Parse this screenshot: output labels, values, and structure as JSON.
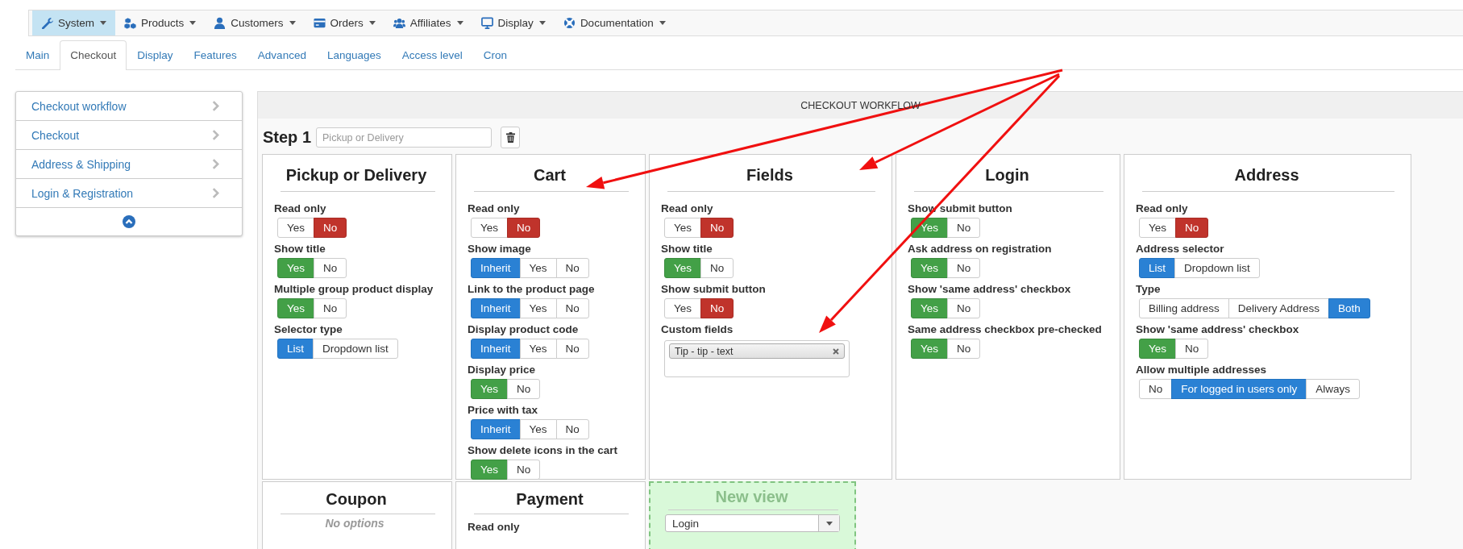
{
  "menu": [
    {
      "label": "System",
      "selected": true
    },
    {
      "label": "Products",
      "selected": false
    },
    {
      "label": "Customers",
      "selected": false
    },
    {
      "label": "Orders",
      "selected": false
    },
    {
      "label": "Affiliates",
      "selected": false
    },
    {
      "label": "Display",
      "selected": false
    },
    {
      "label": "Documentation",
      "selected": false
    }
  ],
  "tabs": [
    {
      "label": "Main",
      "selected": false
    },
    {
      "label": "Checkout",
      "selected": true
    },
    {
      "label": "Display",
      "selected": false
    },
    {
      "label": "Features",
      "selected": false
    },
    {
      "label": "Advanced",
      "selected": false
    },
    {
      "label": "Languages",
      "selected": false
    },
    {
      "label": "Access level",
      "selected": false
    },
    {
      "label": "Cron",
      "selected": false
    }
  ],
  "sidebar": {
    "items": [
      "Checkout workflow",
      "Checkout",
      "Address & Shipping",
      "Login & Registration"
    ]
  },
  "panel": {
    "title": "CHECKOUT WORKFLOW",
    "step": {
      "label": "Step 1",
      "placeholder": "Pickup or Delivery"
    },
    "rows": [
      [
        {
          "kind": "settings",
          "title": "Pickup or Delivery",
          "fields": [
            {
              "label": "Read only",
              "kind": "toggle",
              "options": [
                {
                  "label": "Yes",
                  "kind": "yes",
                  "selected": false
                },
                {
                  "label": "No",
                  "kind": "no",
                  "selected": true
                }
              ]
            },
            {
              "label": "Show title",
              "kind": "toggle",
              "options": [
                {
                  "label": "Yes",
                  "kind": "yes",
                  "selected": true
                },
                {
                  "label": "No",
                  "kind": "no",
                  "selected": false
                }
              ]
            },
            {
              "label": "Multiple group product display",
              "kind": "toggle",
              "options": [
                {
                  "label": "Yes",
                  "kind": "yes",
                  "selected": true
                },
                {
                  "label": "No",
                  "kind": "no",
                  "selected": false
                }
              ]
            },
            {
              "label": "Selector type",
              "kind": "toggle",
              "options": [
                {
                  "label": "List",
                  "kind": "neutral",
                  "selected": true
                },
                {
                  "label": "Dropdown list",
                  "kind": "neutral",
                  "selected": false
                }
              ]
            }
          ]
        },
        {
          "kind": "settings",
          "title": "Cart",
          "fields": [
            {
              "label": "Read only",
              "kind": "toggle",
              "options": [
                {
                  "label": "Yes",
                  "kind": "yes",
                  "selected": false
                },
                {
                  "label": "No",
                  "kind": "no",
                  "selected": true
                }
              ]
            },
            {
              "label": "Show image",
              "kind": "toggle",
              "options": [
                {
                  "label": "Inherit",
                  "kind": "neutral",
                  "selected": true
                },
                {
                  "label": "Yes",
                  "kind": "yes",
                  "selected": false
                },
                {
                  "label": "No",
                  "kind": "no",
                  "selected": false
                }
              ]
            },
            {
              "label": "Link to the product page",
              "kind": "toggle",
              "options": [
                {
                  "label": "Inherit",
                  "kind": "neutral",
                  "selected": true
                },
                {
                  "label": "Yes",
                  "kind": "yes",
                  "selected": false
                },
                {
                  "label": "No",
                  "kind": "no",
                  "selected": false
                }
              ]
            },
            {
              "label": "Display product code",
              "kind": "toggle",
              "options": [
                {
                  "label": "Inherit",
                  "kind": "neutral",
                  "selected": true
                },
                {
                  "label": "Yes",
                  "kind": "yes",
                  "selected": false
                },
                {
                  "label": "No",
                  "kind": "no",
                  "selected": false
                }
              ]
            },
            {
              "label": "Display price",
              "kind": "toggle",
              "options": [
                {
                  "label": "Yes",
                  "kind": "yes",
                  "selected": true
                },
                {
                  "label": "No",
                  "kind": "no",
                  "selected": false
                }
              ]
            },
            {
              "label": "Price with tax",
              "kind": "toggle",
              "options": [
                {
                  "label": "Inherit",
                  "kind": "neutral",
                  "selected": true
                },
                {
                  "label": "Yes",
                  "kind": "yes",
                  "selected": false
                },
                {
                  "label": "No",
                  "kind": "no",
                  "selected": false
                }
              ]
            },
            {
              "label": "Show delete icons in the cart",
              "kind": "toggle",
              "options": [
                {
                  "label": "Yes",
                  "kind": "yes",
                  "selected": true
                },
                {
                  "label": "No",
                  "kind": "no",
                  "selected": false
                }
              ]
            }
          ]
        },
        {
          "kind": "settings",
          "title": "Fields",
          "fields": [
            {
              "label": "Read only",
              "kind": "toggle",
              "options": [
                {
                  "label": "Yes",
                  "kind": "yes",
                  "selected": false
                },
                {
                  "label": "No",
                  "kind": "no",
                  "selected": true
                }
              ]
            },
            {
              "label": "Show title",
              "kind": "toggle",
              "options": [
                {
                  "label": "Yes",
                  "kind": "yes",
                  "selected": true
                },
                {
                  "label": "No",
                  "kind": "no",
                  "selected": false
                }
              ]
            },
            {
              "label": "Show submit button",
              "kind": "toggle",
              "options": [
                {
                  "label": "Yes",
                  "kind": "yes",
                  "selected": false
                },
                {
                  "label": "No",
                  "kind": "no",
                  "selected": true
                }
              ]
            },
            {
              "label": "Custom fields",
              "kind": "tags",
              "tags": [
                "Tip - tip - text"
              ]
            }
          ]
        },
        {
          "kind": "settings",
          "title": "Login",
          "fields": [
            {
              "label": "Show submit button",
              "kind": "toggle",
              "options": [
                {
                  "label": "Yes",
                  "kind": "yes",
                  "selected": true
                },
                {
                  "label": "No",
                  "kind": "no",
                  "selected": false
                }
              ]
            },
            {
              "label": "Ask address on registration",
              "kind": "toggle",
              "options": [
                {
                  "label": "Yes",
                  "kind": "yes",
                  "selected": true
                },
                {
                  "label": "No",
                  "kind": "no",
                  "selected": false
                }
              ]
            },
            {
              "label": "Show 'same address' checkbox",
              "kind": "toggle",
              "options": [
                {
                  "label": "Yes",
                  "kind": "yes",
                  "selected": true
                },
                {
                  "label": "No",
                  "kind": "no",
                  "selected": false
                }
              ]
            },
            {
              "label": "Same address checkbox pre-checked",
              "kind": "toggle",
              "options": [
                {
                  "label": "Yes",
                  "kind": "yes",
                  "selected": true
                },
                {
                  "label": "No",
                  "kind": "no",
                  "selected": false
                }
              ]
            }
          ]
        },
        {
          "kind": "settings",
          "title": "Address",
          "fields": [
            {
              "label": "Read only",
              "kind": "toggle",
              "options": [
                {
                  "label": "Yes",
                  "kind": "yes",
                  "selected": false
                },
                {
                  "label": "No",
                  "kind": "no",
                  "selected": true
                }
              ]
            },
            {
              "label": "Address selector",
              "kind": "toggle",
              "options": [
                {
                  "label": "List",
                  "kind": "neutral",
                  "selected": true
                },
                {
                  "label": "Dropdown list",
                  "kind": "neutral",
                  "selected": false
                }
              ]
            },
            {
              "label": "Type",
              "kind": "toggle",
              "options": [
                {
                  "label": "Billing address",
                  "kind": "neutral",
                  "selected": false
                },
                {
                  "label": "Delivery Address",
                  "kind": "neutral",
                  "selected": false
                },
                {
                  "label": "Both",
                  "kind": "neutral",
                  "selected": true
                }
              ]
            },
            {
              "label": "Show 'same address' checkbox",
              "kind": "toggle",
              "options": [
                {
                  "label": "Yes",
                  "kind": "yes",
                  "selected": true
                },
                {
                  "label": "No",
                  "kind": "no",
                  "selected": false
                }
              ]
            },
            {
              "label": "Allow multiple addresses",
              "kind": "toggle",
              "options": [
                {
                  "label": "No",
                  "kind": "neutral",
                  "selected": false
                },
                {
                  "label": "For logged in users only",
                  "kind": "neutral",
                  "selected": true
                },
                {
                  "label": "Always",
                  "kind": "neutral",
                  "selected": false
                }
              ]
            }
          ]
        }
      ],
      [
        {
          "kind": "empty",
          "title": "Coupon",
          "note": "No options"
        },
        {
          "kind": "settings",
          "title": "Payment",
          "fields": [
            {
              "label": "Read only",
              "kind": "label"
            }
          ]
        },
        {
          "kind": "new_view",
          "title": "New view",
          "value": "Login"
        }
      ]
    ]
  }
}
